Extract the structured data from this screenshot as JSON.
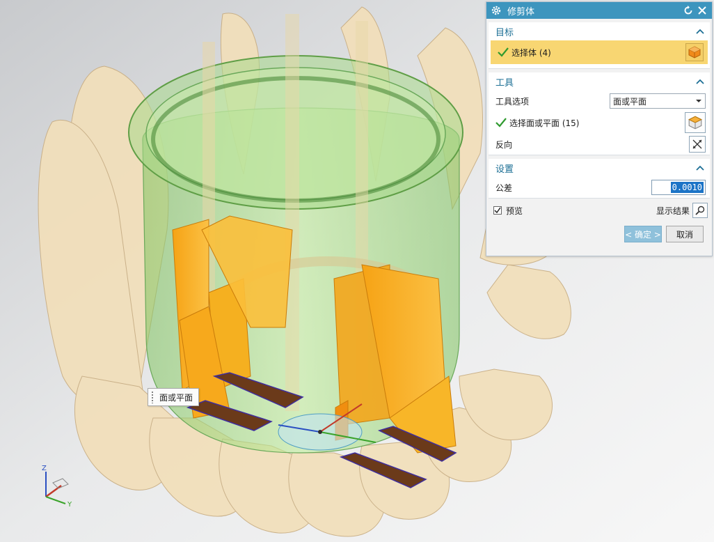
{
  "dialog": {
    "title": "修剪体",
    "target": {
      "header": "目标",
      "select_label": "选择体 (4)"
    },
    "tool": {
      "header": "工具",
      "option_label": "工具选项",
      "option_value": "面或平面",
      "select_label": "选择面或平面 (15)",
      "reverse_label": "反向"
    },
    "settings": {
      "header": "设置",
      "tolerance_label": "公差",
      "tolerance_value": "0.0010"
    },
    "preview_label": "预览",
    "show_result_label": "显示结果",
    "ok_label": "< 确定 >",
    "cancel_label": "取消"
  },
  "tooltip": {
    "text": "面或平面"
  },
  "triad": {
    "z": "Z",
    "y": "Y"
  },
  "colors": {
    "titlebar": "#3d95be",
    "section_header": "#1c6f95",
    "selection_highlight": "#f8d672",
    "tool_face": "#f7a91c",
    "body_green": "#9edc7e",
    "fins": "#f2ddb4"
  },
  "icons": [
    "gear-icon",
    "reset-icon",
    "close-icon",
    "collapse-icon",
    "check-icon",
    "solid-cube-icon",
    "face-cube-icon",
    "reverse-icon",
    "dropdown-arrow-icon",
    "magnifier-icon"
  ]
}
